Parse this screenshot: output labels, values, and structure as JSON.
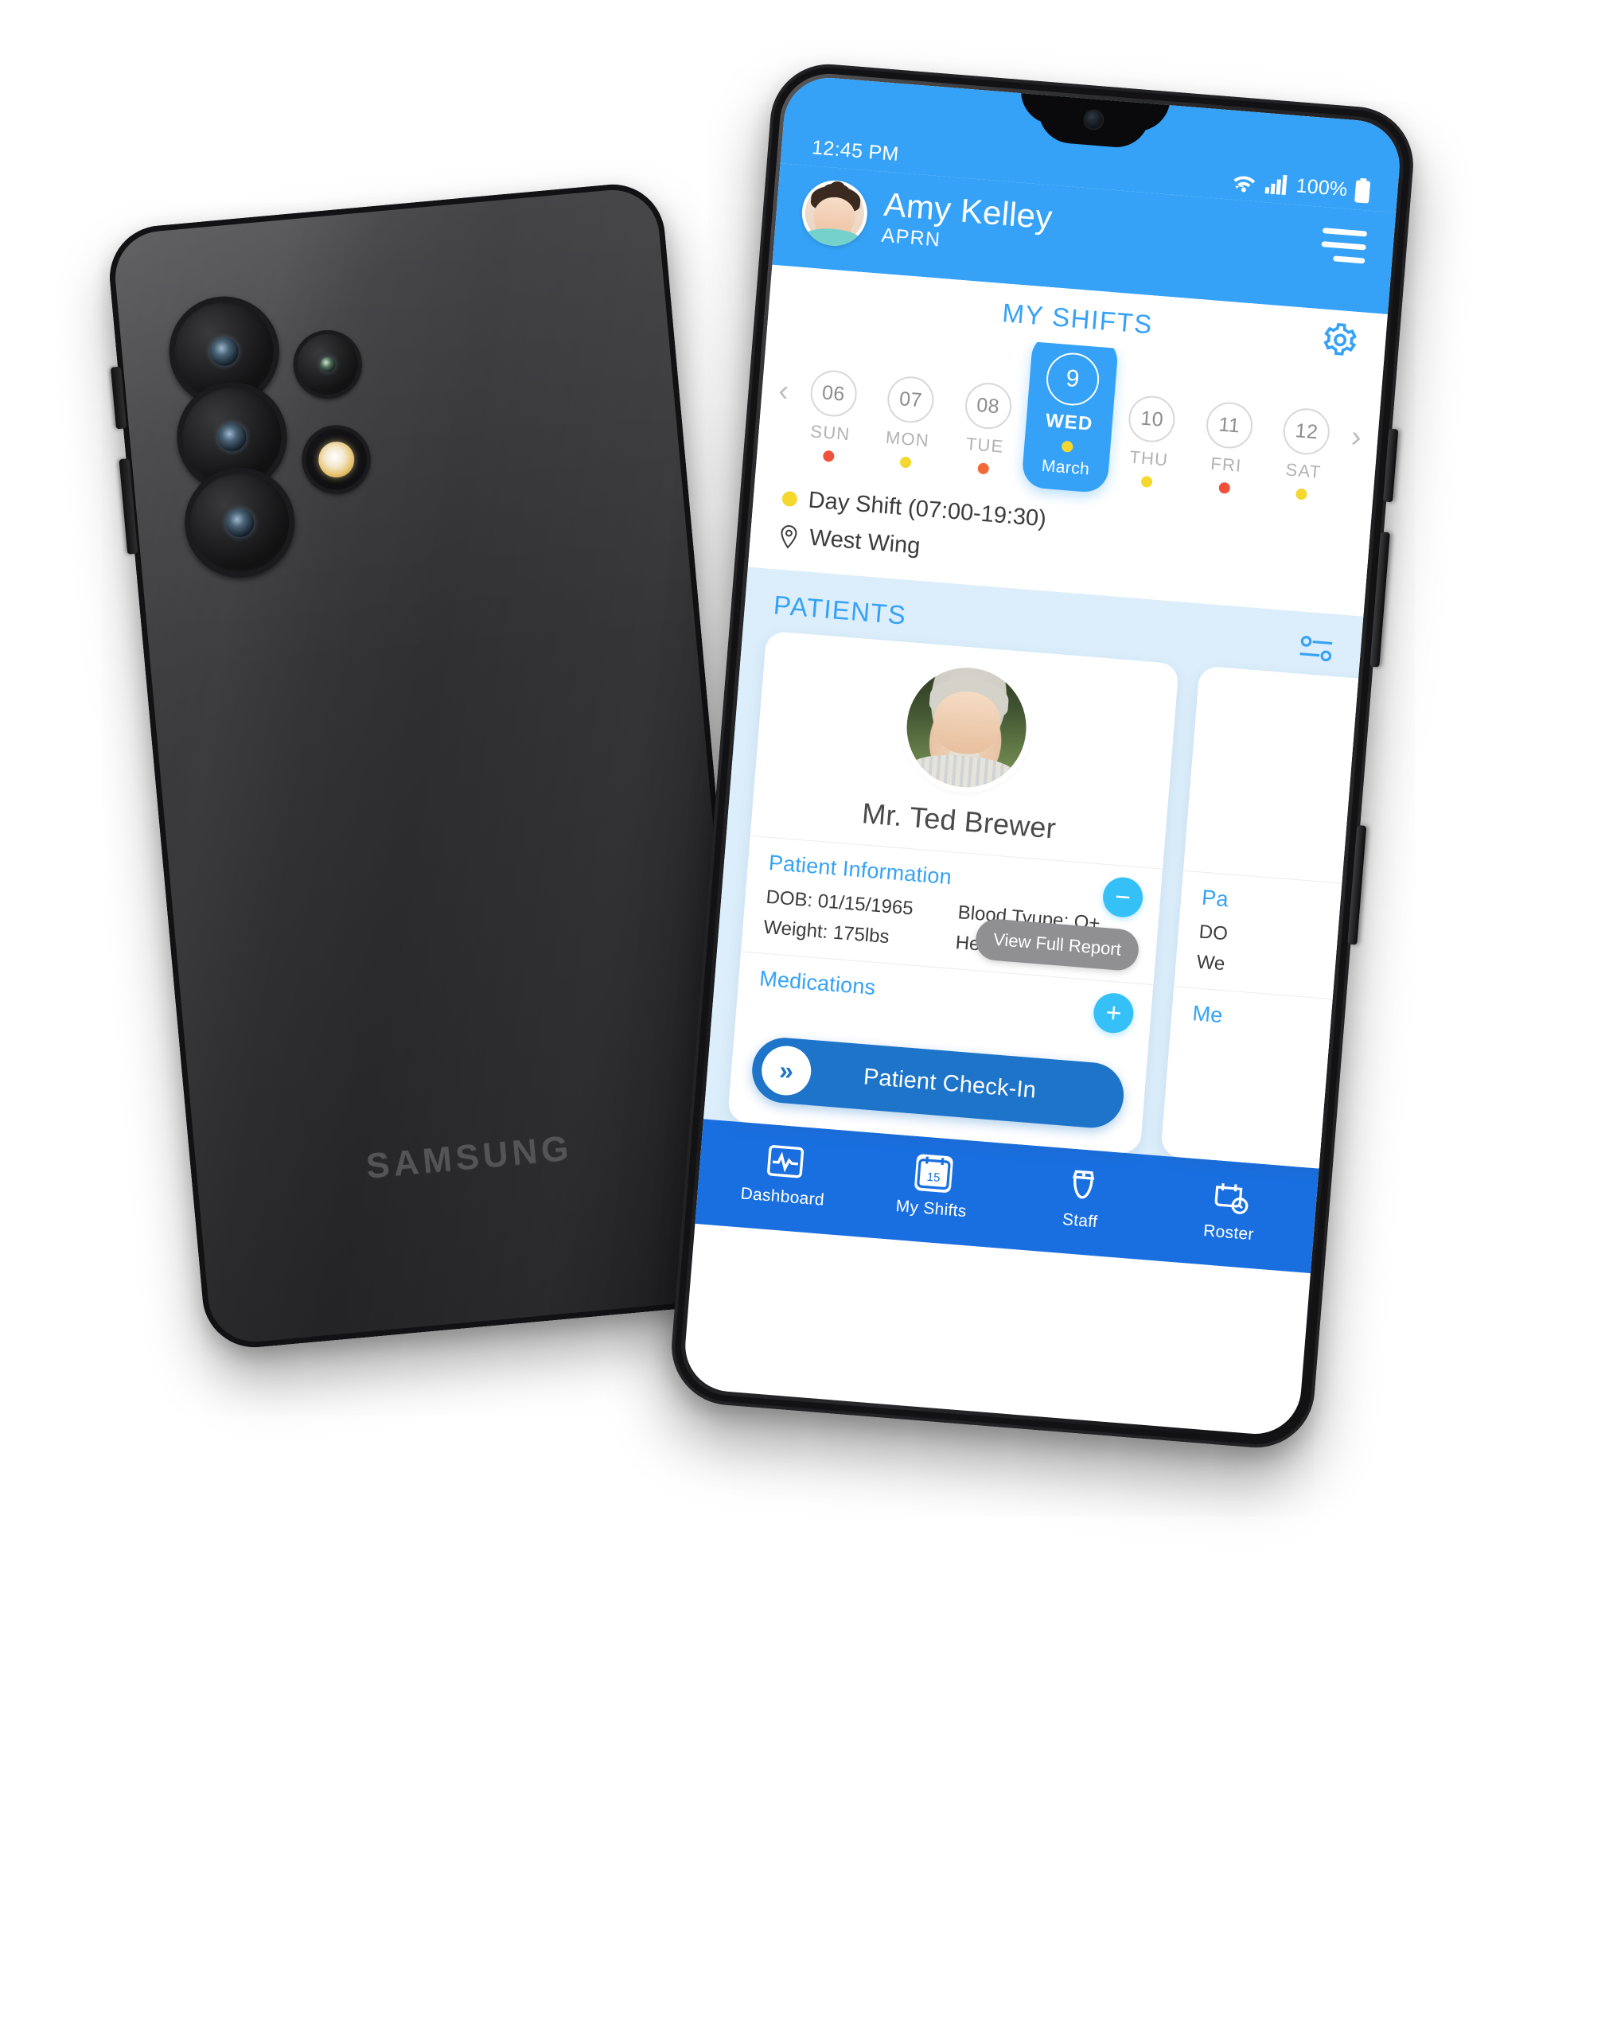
{
  "device": {
    "brand_logo": "SAMSUNG",
    "back_view_name": "samsung-galaxy-back",
    "front_view_name": "samsung-galaxy-front"
  },
  "status_bar": {
    "time": "12:45 PM",
    "battery_percent": "100%",
    "icons": [
      "wifi-icon",
      "cellular-signal-icon",
      "battery-icon"
    ]
  },
  "header": {
    "user_name": "Amy Kelley",
    "user_role": "APRN",
    "avatar_name": "user-avatar",
    "menu_icon": "hamburger-menu-icon",
    "accent_color": "#35a2f7"
  },
  "shifts": {
    "title": "MY SHIFTS",
    "settings_icon": "gear-icon",
    "prev_icon": "chevron-left-icon",
    "next_icon": "chevron-right-icon",
    "days": [
      {
        "num": "06",
        "dow": "SUN",
        "dot": "#f0513a",
        "selected": false
      },
      {
        "num": "07",
        "dow": "MON",
        "dot": "#f5d82e",
        "selected": false
      },
      {
        "num": "08",
        "dow": "TUE",
        "dot": "#f26a3a",
        "selected": false
      },
      {
        "num": "9",
        "dow": "WED",
        "dot": "#f5d82e",
        "selected": true,
        "month": "March"
      },
      {
        "num": "10",
        "dow": "THU",
        "dot": "#f5d82e",
        "selected": false
      },
      {
        "num": "11",
        "dow": "FRI",
        "dot": "#f0513a",
        "selected": false
      },
      {
        "num": "12",
        "dow": "SAT",
        "dot": "#f5d82e",
        "selected": false
      }
    ],
    "shift_label": "Day Shift (07:00-19:30)",
    "shift_dot_color": "#f5d82e",
    "location": "West Wing",
    "location_icon": "location-pin-icon"
  },
  "patients": {
    "title": "PATIENTS",
    "filter_icon": "filter-sliders-icon",
    "cards": [
      {
        "name": "Mr. Ted Brewer",
        "photo_name": "patient-photo",
        "info_title": "Patient Information",
        "collapse_icon": "minus-circle-icon",
        "fields": [
          "DOB: 01/15/1965",
          "Blood Tyupe: O+",
          "Weight: 175lbs",
          "Height: 6'1\""
        ],
        "report_button": "View Full Report",
        "medications_title": "Medications",
        "add_icon": "plus-circle-icon",
        "checkin_button": "Patient Check-In",
        "checkin_icon": "double-chevron-right-icon"
      },
      {
        "info_title": "Pa",
        "fields": [
          "DO",
          "We"
        ],
        "medications_title": "Me"
      }
    ]
  },
  "bottom_nav": {
    "items": [
      {
        "label": "Dashboard",
        "icon": "vitals-monitor-icon",
        "active": false
      },
      {
        "label": "My Shifts",
        "icon": "calendar-15-icon",
        "active": true
      },
      {
        "label": "Staff",
        "icon": "nurse-icon",
        "active": false
      },
      {
        "label": "Roster",
        "icon": "calendar-clock-icon",
        "active": false
      }
    ]
  }
}
